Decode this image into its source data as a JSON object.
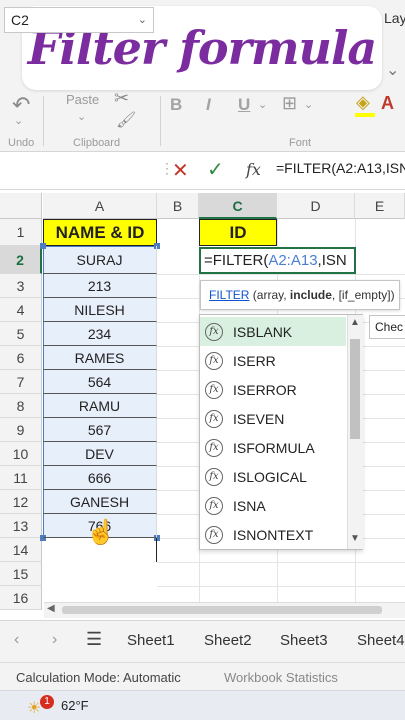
{
  "ribbon": {
    "title": "Filter formula",
    "lay_partial": "Lay",
    "paste_label": "Paste",
    "undo_group": "Undo",
    "clipboard_group": "Clipboard",
    "font_group": "Font"
  },
  "formula_bar": {
    "name_box": "C2",
    "formula": "=FILTER(A2:A13,ISN"
  },
  "columns": [
    "A",
    "B",
    "C",
    "D",
    "E"
  ],
  "rows": [
    "1",
    "2",
    "3",
    "4",
    "5",
    "6",
    "7",
    "8",
    "9",
    "10",
    "11",
    "12",
    "13",
    "14",
    "15",
    "16"
  ],
  "sheet": {
    "a1": "NAME & ID",
    "c1": "ID",
    "a_values": [
      "SURAJ",
      "213",
      "NILESH",
      "234",
      "RAMES",
      "564",
      "RAMU",
      "567",
      "DEV",
      "666",
      "GANESH",
      "766"
    ]
  },
  "active_cell": {
    "prefix": "=FILTER(",
    "range": "A2:A13",
    "suffix": ",ISN"
  },
  "tooltip": {
    "fn": "FILTER",
    "open": " (array, ",
    "bold_arg": "include",
    "rest": ", [if_empty])"
  },
  "autocomplete": {
    "items": [
      "ISBLANK",
      "ISERR",
      "ISERROR",
      "ISEVEN",
      "ISFORMULA",
      "ISLOGICAL",
      "ISNA",
      "ISNONTEXT"
    ],
    "selected_index": 0,
    "check_label": "Chec"
  },
  "sheet_tabs": [
    "Sheet1",
    "Sheet2",
    "Sheet3",
    "Sheet4"
  ],
  "status": {
    "calc_mode": "Calculation Mode: Automatic",
    "workbook_stats": "Workbook Statistics"
  },
  "taskbar": {
    "badge": "1",
    "temperature": "62°F"
  },
  "colors": {
    "accent_green": "#217346",
    "title_purple": "#7b2c9e",
    "header_yellow": "#ffff00"
  }
}
